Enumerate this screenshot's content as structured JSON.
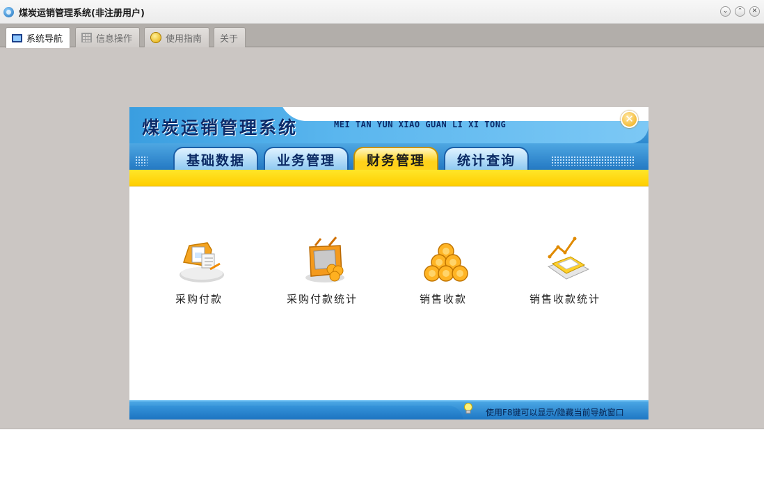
{
  "window": {
    "title": "煤炭运销管理系统(非注册用户)",
    "buttons": [
      "minimize",
      "maximize",
      "close"
    ]
  },
  "tabs": [
    {
      "label": "系统导航",
      "icon": "monitor-icon",
      "active": true
    },
    {
      "label": "信息操作",
      "icon": "grid-icon",
      "active": false
    },
    {
      "label": "使用指南",
      "icon": "help-icon",
      "active": false
    },
    {
      "label": "关于",
      "icon": null,
      "active": false
    }
  ],
  "panel": {
    "title": "煤炭运销管理系统",
    "pinyin": "MEI TAN YUN XIAO GUAN LI XI TONG",
    "nav": [
      {
        "label": "基础数据",
        "active": false
      },
      {
        "label": "业务管理",
        "active": false
      },
      {
        "label": "财务管理",
        "active": true
      },
      {
        "label": "统计查询",
        "active": false
      }
    ],
    "items": [
      {
        "label": "采购付款",
        "icon": "purchase-payment-icon"
      },
      {
        "label": "采购付款统计",
        "icon": "purchase-stats-icon"
      },
      {
        "label": "销售收款",
        "icon": "coins-icon"
      },
      {
        "label": "销售收款统计",
        "icon": "sales-stats-icon"
      }
    ],
    "footer_hint": "使用F8键可以显示/隐藏当前导航窗口"
  },
  "colors": {
    "accent_blue": "#2f8bd0",
    "accent_yellow": "#ffd21a",
    "window_bg": "#cbc6c3"
  }
}
